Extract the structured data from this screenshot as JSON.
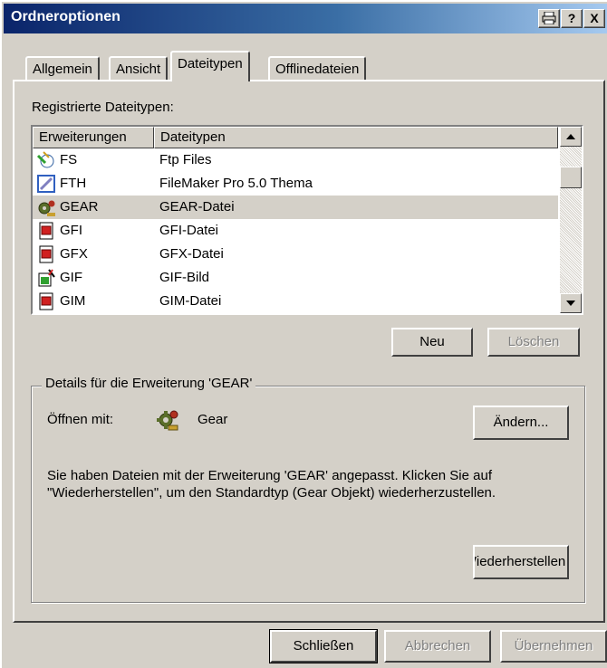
{
  "window": {
    "title": "Ordneroptionen",
    "buttons": [
      "🖶",
      "?",
      "X"
    ]
  },
  "tabs": [
    {
      "label": "Allgemein",
      "active": false
    },
    {
      "label": "Ansicht",
      "active": false
    },
    {
      "label": "Dateitypen",
      "active": true
    },
    {
      "label": "Offlinedateien",
      "active": false
    }
  ],
  "registered_label": "Registrierte Dateitypen:",
  "list": {
    "columns": [
      "Erweiterungen",
      "Dateitypen"
    ],
    "rows": [
      {
        "ext": "FS",
        "type": "Ftp Files",
        "icon": "ftp-icon",
        "selected": false
      },
      {
        "ext": "FTH",
        "type": "FileMaker Pro 5.0 Thema",
        "icon": "filemaker-theme-icon",
        "selected": false
      },
      {
        "ext": "GEAR",
        "type": "GEAR-Datei",
        "icon": "gear-icon",
        "selected": true
      },
      {
        "ext": "GFI",
        "type": "GFI-Datei",
        "icon": "document-icon",
        "selected": false
      },
      {
        "ext": "GFX",
        "type": "GFX-Datei",
        "icon": "document-icon",
        "selected": false
      },
      {
        "ext": "GIF",
        "type": "GIF-Bild",
        "icon": "image-icon",
        "selected": false
      },
      {
        "ext": "GIM",
        "type": "GIM-Datei",
        "icon": "document-icon",
        "selected": false
      }
    ]
  },
  "buttons": {
    "new": "Neu",
    "delete": "Löschen",
    "change": "Ändern...",
    "restore": "Wiederherstellen",
    "close": "Schließen",
    "cancel": "Abbrechen",
    "apply": "Übernehmen"
  },
  "details": {
    "legend": "Details für die Erweiterung 'GEAR'",
    "open_with_label": "Öffnen mit:",
    "open_with_app": "Gear",
    "open_with_icon": "gear-icon",
    "description": "Sie haben Dateien mit der Erweiterung 'GEAR' angepasst. Klicken Sie auf \"Wiederherstellen\", um den Standardtyp (Gear Objekt) wiederherzustellen."
  },
  "colors": {
    "titlebar_start": "#0a246a",
    "titlebar_end": "#a6caf0",
    "face": "#d4d0c8"
  }
}
